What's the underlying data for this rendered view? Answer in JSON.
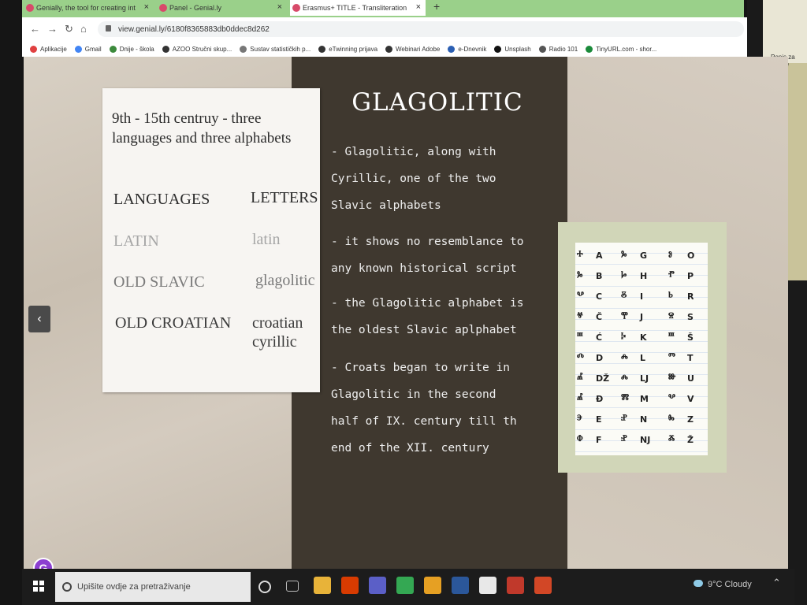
{
  "browser": {
    "tabs": [
      {
        "title": "Genially, the tool for creating int",
        "close": "×"
      },
      {
        "title": "Panel - Genial.ly",
        "close": "×"
      },
      {
        "title": "Erasmus+ TITLE - Transliteration",
        "close": "×"
      }
    ],
    "new_tab": "+",
    "url": "view.genial.ly/6180f8365883db0ddec8d262",
    "bookmarks": [
      {
        "label": "Aplikacije",
        "icon": "apps-grid-icon",
        "color": "#e04040"
      },
      {
        "label": "Gmail",
        "icon": "google-g-icon",
        "color": "#4285f4"
      },
      {
        "label": "Dnije - škola",
        "icon": "shield-icon",
        "color": "#3c8a3c"
      },
      {
        "label": "AZOO Stručni skup...",
        "icon": "globe-icon",
        "color": "#333333"
      },
      {
        "label": "Sustav statističkih p...",
        "icon": "document-icon",
        "color": "#777777"
      },
      {
        "label": "eTwinning prijava",
        "icon": "etwinning-icon",
        "color": "#333333"
      },
      {
        "label": "Webinari Adobe",
        "icon": "globe-icon",
        "color": "#333333"
      },
      {
        "label": "e-Dnevnik",
        "icon": "edn-icon",
        "color": "#2b5fb3"
      },
      {
        "label": "Unsplash",
        "icon": "camera-icon",
        "color": "#111111"
      },
      {
        "label": "Radio 101",
        "icon": "radio-icon",
        "color": "#555555"
      },
      {
        "label": "TinyURL.com - shor...",
        "icon": "link-icon",
        "color": "#1a8a3a"
      }
    ]
  },
  "slide": {
    "title": "GLAGOLITIC",
    "paragraphs": [
      "- Glagolitic, along with\nCyrillic, one of the two\nSlavic alphabets",
      "- it shows no resemblance to\nany known historical script",
      "- the Glagolitic alphabet is\nthe oldest Slavic aplphabet",
      "- Croats began to write in\nGlagolitic in the second\nhalf of IX. century till th\nend of the XII. century"
    ],
    "card": {
      "title": "9th - 15th centruy - three languages and three alphabets",
      "languages_header": "LANGUAGES",
      "letters_header": "LETTERS",
      "rows": [
        {
          "language": "LATIN",
          "letters": "latin",
          "color": "#a6a6a6"
        },
        {
          "language": "OLD SLAVIC",
          "letters": "glagolitic",
          "color": "#7a7a7a"
        },
        {
          "language": "OLD CROATIAN",
          "letters": "croatian\ncyrillic",
          "color": "#3a3a3a"
        }
      ]
    },
    "alphabet": [
      [
        {
          "g": "ⰰ",
          "l": "A"
        },
        {
          "g": "ⰳ",
          "l": "B"
        },
        {
          "g": "ⰲ",
          "l": "C"
        },
        {
          "g": "ⱍ",
          "l": "Č"
        },
        {
          "g": "ⱎ",
          "l": "Ć"
        },
        {
          "g": "ⰴ",
          "l": "D"
        },
        {
          "g": "ⰼ",
          "l": "DŽ"
        },
        {
          "g": "ⰼ",
          "l": "Đ"
        },
        {
          "g": "ⰵ",
          "l": "E"
        },
        {
          "g": "ⱇ",
          "l": "F"
        }
      ],
      [
        {
          "g": "ⰳ",
          "l": "G"
        },
        {
          "g": "ⱈ",
          "l": "H"
        },
        {
          "g": "ⰻ",
          "l": "I"
        },
        {
          "g": "ⰹ",
          "l": "J"
        },
        {
          "g": "ⰽ",
          "l": "K"
        },
        {
          "g": "ⰾ",
          "l": "L"
        },
        {
          "g": "ⰾ",
          "l": "LJ"
        },
        {
          "g": "ⰿ",
          "l": "M"
        },
        {
          "g": "ⱀ",
          "l": "N"
        },
        {
          "g": "ⱀ",
          "l": "NJ"
        }
      ],
      [
        {
          "g": "ⱁ",
          "l": "O"
        },
        {
          "g": "ⱂ",
          "l": "P"
        },
        {
          "g": "ⱃ",
          "l": "R"
        },
        {
          "g": "ⱄ",
          "l": "S"
        },
        {
          "g": "ⱎ",
          "l": "Š"
        },
        {
          "g": "ⱅ",
          "l": "T"
        },
        {
          "g": "ⱆ",
          "l": "U"
        },
        {
          "g": "ⰲ",
          "l": "V"
        },
        {
          "g": "ⰸ",
          "l": "Z"
        },
        {
          "g": "ⰶ",
          "l": "Ž"
        }
      ]
    ],
    "prev_arrow": "‹",
    "logo_letter": "G"
  },
  "taskbar": {
    "search_placeholder": "Upišite ovdje za pretraživanje",
    "weather": "9°C Cloudy",
    "apps": [
      {
        "icon": "cortana-icon",
        "color": "#1c1c1c"
      },
      {
        "icon": "task-view-icon",
        "color": "#1c1c1c"
      },
      {
        "icon": "file-explorer-icon",
        "color": "#e8b339"
      },
      {
        "icon": "office-icon",
        "color": "#d83b01"
      },
      {
        "icon": "teams-icon",
        "color": "#5b5fc7"
      },
      {
        "icon": "chrome-icon",
        "color": "#34a853"
      },
      {
        "icon": "paint-icon",
        "color": "#e6a023"
      },
      {
        "icon": "word-icon",
        "color": "#2b579a"
      },
      {
        "icon": "notepad-icon",
        "color": "#e8e8e8"
      },
      {
        "icon": "presentation-icon",
        "color": "#c0392b"
      },
      {
        "icon": "powerpoint-icon",
        "color": "#d24726"
      }
    ]
  },
  "side_panel": {
    "label": "Popis za čitanje"
  }
}
